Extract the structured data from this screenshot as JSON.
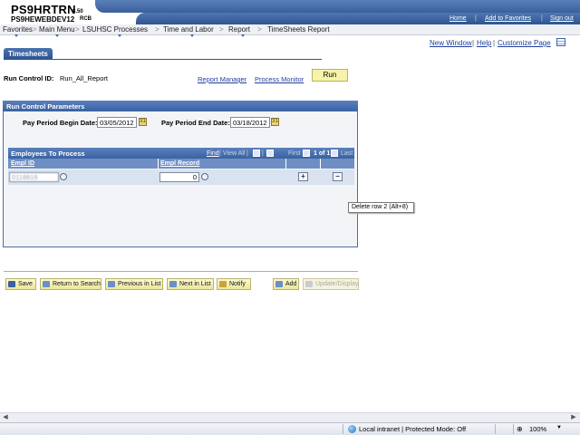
{
  "header": {
    "app_name": "PS9HRTRN",
    "version": "8.50",
    "database": "PS9HEWEBDEV12",
    "user": "RCB",
    "links": {
      "home": "Home",
      "add_favorites": "Add to Favorites",
      "sign_out": "Sign out"
    }
  },
  "breadcrumb": {
    "items": [
      "Favorites",
      "Main Menu",
      "LSUHSC Processes",
      "Time and Labor",
      "Report",
      "TimeSheets Report"
    ],
    "separator": ">"
  },
  "page_links": {
    "new_window": "New Window",
    "help": "Help",
    "customize_page": "Customize Page",
    "divider": "|"
  },
  "tab": {
    "label": "Timesheets"
  },
  "run_control": {
    "label": "Run Control ID:",
    "value": "Run_All_Report",
    "report_manager": "Report Manager",
    "process_monitor": "Process Monitor",
    "run_button": "Run"
  },
  "params": {
    "title": "Run Control Parameters",
    "begin_label": "Pay Period Begin Date:",
    "begin_value": "03/05/2012",
    "end_label": "Pay Period End Date:",
    "end_value": "03/18/2012"
  },
  "grid": {
    "title": "Employees To Process",
    "find": "Find",
    "view_all": "View All",
    "first": "First",
    "page_info": "1 of 1",
    "last": "Last",
    "columns": [
      "Empl ID",
      "Empl Record"
    ],
    "rows": [
      {
        "emplid": "0118816",
        "empl_record": "0"
      }
    ],
    "add_symbol": "+",
    "delete_symbol": "−"
  },
  "tooltip": {
    "text": "Delete row 2 (Alt+8)"
  },
  "toolbar": {
    "save": "Save",
    "return_to_search": "Return to Search",
    "previous_in_list": "Previous in List",
    "next_in_list": "Next in List",
    "notify": "Notify",
    "add": "Add",
    "update_display": "Update/Display"
  },
  "statusbar": {
    "zone": "Local intranet | Protected Mode: Off",
    "zoom": "100%"
  },
  "colors": {
    "header_blue": "#3b5f9c",
    "link_blue": "#1f3f9c",
    "button_yellow": "#f5f3a8"
  }
}
